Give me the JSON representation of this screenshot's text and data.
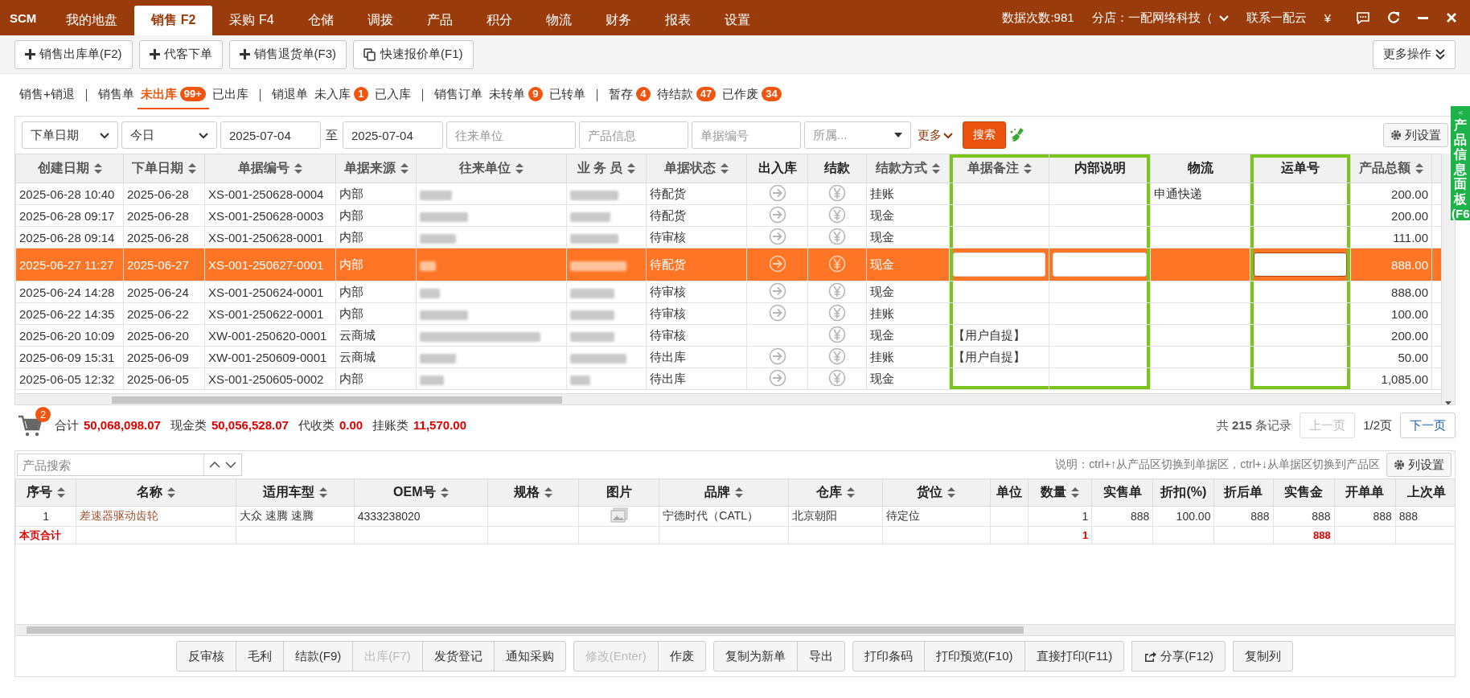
{
  "topbar": {
    "logo": "SCM",
    "menu": [
      {
        "label": "我的地盘",
        "selected": false
      },
      {
        "label": "销售 F2",
        "selected": true
      },
      {
        "label": "采购 F4",
        "selected": false
      },
      {
        "label": "仓储",
        "selected": false
      },
      {
        "label": "调拨",
        "selected": false
      },
      {
        "label": "产品",
        "selected": false
      },
      {
        "label": "积分",
        "selected": false
      },
      {
        "label": "物流",
        "selected": false
      },
      {
        "label": "财务",
        "selected": false
      },
      {
        "label": "报表",
        "selected": false
      },
      {
        "label": "设置",
        "selected": false
      }
    ],
    "data_count": "数据次数:981",
    "branch": "分店：一配网络科技（",
    "contact": "联系一配云",
    "currency": "¥"
  },
  "toolbar": {
    "buttons": [
      {
        "label": "销售出库单(F2)",
        "kind": "add"
      },
      {
        "label": "代客下单",
        "kind": "add"
      },
      {
        "label": "销售退货单(F3)",
        "kind": "add"
      },
      {
        "label": "快速报价单(F1)",
        "kind": "copy"
      }
    ],
    "more": "更多操作"
  },
  "status_tabs": [
    [
      {
        "label": "销售+销退",
        "selected": false
      }
    ],
    [
      {
        "label": "销售单",
        "selected": false
      },
      {
        "label": "未出库",
        "count": "99+",
        "selected": true
      },
      {
        "label": "已出库",
        "selected": false
      }
    ],
    [
      {
        "label": "销退单",
        "selected": false
      },
      {
        "label": "未入库",
        "count": "1",
        "selected": false
      },
      {
        "label": "已入库",
        "selected": false
      }
    ],
    [
      {
        "label": "销售订单",
        "selected": false
      },
      {
        "label": "未转单",
        "count": "9",
        "selected": false
      },
      {
        "label": "已转单",
        "selected": false
      }
    ],
    [
      {
        "label": "暂存",
        "count": "4",
        "selected": false
      },
      {
        "label": "待结款",
        "count": "47",
        "selected": false
      },
      {
        "label": "已作废",
        "count": "34",
        "selected": false
      }
    ]
  ],
  "filters": {
    "date_type": "下单日期",
    "period": "今日",
    "date_from": "2025-07-04",
    "to": "至",
    "date_to": "2025-07-04",
    "partner": {
      "placeholder": "往来单位"
    },
    "product": {
      "placeholder": "产品信息"
    },
    "order_no": {
      "placeholder": "单据编号"
    },
    "owner": {
      "placeholder": "所属..."
    },
    "more": "更多",
    "search": "搜索",
    "column_settings": "列设置"
  },
  "orders": {
    "columns": [
      {
        "label": "创建日期",
        "sortable": true,
        "kind": "text"
      },
      {
        "label": "下单日期",
        "sortable": true,
        "kind": "text"
      },
      {
        "label": "单据编号",
        "sortable": true,
        "kind": "text"
      },
      {
        "label": "单据来源",
        "sortable": true,
        "kind": "text"
      },
      {
        "label": "往来单位",
        "sortable": true,
        "kind": "blurred"
      },
      {
        "label": "业 务 员",
        "sortable": true,
        "kind": "blurred"
      },
      {
        "label": "单据状态",
        "sortable": true,
        "kind": "text"
      },
      {
        "label": "出入库",
        "sortable": false,
        "kind": "arrow"
      },
      {
        "label": "结款",
        "sortable": false,
        "kind": "yen"
      },
      {
        "label": "结款方式",
        "sortable": true,
        "kind": "text"
      },
      {
        "label": "单据备注",
        "sortable": true,
        "kind": "text",
        "highlighted": true,
        "editable": true
      },
      {
        "label": "内部说明",
        "sortable": false,
        "kind": "text",
        "highlighted": true,
        "editable": true
      },
      {
        "label": "物流",
        "sortable": false,
        "kind": "text"
      },
      {
        "label": "运单号",
        "sortable": false,
        "kind": "text",
        "highlighted": true,
        "editable": true,
        "focused": true
      },
      {
        "label": "产品总额",
        "sortable": true,
        "kind": "number"
      }
    ],
    "rows": [
      {
        "selected": false,
        "outbound": true,
        "cells": [
          "2025-06-28 10:40",
          "2025-06-28",
          "XS-001-250628-0004",
          "内部",
          null,
          null,
          "待配货",
          null,
          null,
          "挂账",
          null,
          null,
          "申通快递",
          null,
          "200.00"
        ]
      },
      {
        "selected": false,
        "outbound": true,
        "cells": [
          "2025-06-28 09:17",
          "2025-06-28",
          "XS-001-250628-0003",
          "内部",
          null,
          null,
          "待配货",
          null,
          null,
          "现金",
          null,
          null,
          null,
          null,
          "200.00"
        ]
      },
      {
        "selected": false,
        "outbound": true,
        "cells": [
          "2025-06-28 09:14",
          "2025-06-28",
          "XS-001-250628-0001",
          "内部",
          null,
          null,
          "待审核",
          null,
          null,
          "现金",
          null,
          null,
          null,
          null,
          "111.00"
        ]
      },
      {
        "selected": true,
        "outbound": true,
        "cells": [
          "2025-06-27 11:27",
          "2025-06-27",
          "XS-001-250627-0001",
          "内部",
          null,
          null,
          "待配货",
          null,
          null,
          "现金",
          null,
          null,
          null,
          null,
          "888.00"
        ]
      },
      {
        "selected": false,
        "outbound": true,
        "cells": [
          "2025-06-24 14:28",
          "2025-06-24",
          "XS-001-250624-0001",
          "内部",
          null,
          null,
          "待审核",
          null,
          null,
          "现金",
          null,
          null,
          null,
          null,
          "888.00"
        ]
      },
      {
        "selected": false,
        "outbound": true,
        "cells": [
          "2025-06-22 14:35",
          "2025-06-22",
          "XS-001-250622-0001",
          "内部",
          null,
          null,
          "待审核",
          null,
          null,
          "挂账",
          null,
          null,
          null,
          null,
          "100.00"
        ]
      },
      {
        "selected": false,
        "outbound": false,
        "cells": [
          "2025-06-20 10:09",
          "2025-06-20",
          "XW-001-250620-0001",
          "云商城",
          null,
          null,
          "待审核",
          null,
          null,
          "现金",
          "【用户自提】",
          null,
          null,
          null,
          "200.00"
        ]
      },
      {
        "selected": false,
        "outbound": true,
        "cells": [
          "2025-06-09 15:31",
          "2025-06-09",
          "XW-001-250609-0001",
          "云商城",
          null,
          null,
          "待出库",
          null,
          null,
          "挂账",
          "【用户自提】",
          null,
          null,
          null,
          "50.00"
        ]
      },
      {
        "selected": false,
        "outbound": true,
        "cells": [
          "2025-06-05 12:32",
          "2025-06-05",
          "XS-001-250605-0002",
          "内部",
          null,
          null,
          "待出库",
          null,
          null,
          "现金",
          null,
          null,
          null,
          null,
          "1,085.00"
        ]
      }
    ]
  },
  "summary": {
    "cart_count": "2",
    "totals": [
      {
        "label": "合计",
        "value": "50,068,098.07"
      },
      {
        "label": "现金类",
        "value": "50,056,528.07"
      },
      {
        "label": "代收类",
        "value": "0.00"
      },
      {
        "label": "挂账类",
        "value": "11,570.00"
      }
    ],
    "records": "共 **215** 条记录",
    "prev": {
      "label": "上一页",
      "disabled": true
    },
    "page": "1/2页",
    "next": {
      "label": "下一页",
      "disabled": false
    }
  },
  "products": {
    "search": {
      "placeholder": "产品搜索"
    },
    "hint": "说明：ctrl+↑从产品区切换到单据区，ctrl+↓从单据区切换到产品区",
    "column_settings": "列设置",
    "columns": [
      {
        "label": "序号",
        "sortable": true,
        "kind": "center",
        "page_total": "本页合计"
      },
      {
        "label": "名称",
        "sortable": true,
        "kind": "link"
      },
      {
        "label": "适用车型",
        "sortable": true,
        "kind": "text"
      },
      {
        "label": "OEM号",
        "sortable": true,
        "kind": "text"
      },
      {
        "label": "规格",
        "sortable": true,
        "kind": "text"
      },
      {
        "label": "图片",
        "sortable": false,
        "kind": "image"
      },
      {
        "label": "品牌",
        "sortable": true,
        "kind": "text"
      },
      {
        "label": "仓库",
        "sortable": true,
        "kind": "text"
      },
      {
        "label": "货位",
        "sortable": true,
        "kind": "text"
      },
      {
        "label": "单位",
        "sortable": false,
        "kind": "text"
      },
      {
        "label": "数量",
        "sortable": true,
        "kind": "number",
        "page_total": "1"
      },
      {
        "label": "实售单",
        "sortable": false,
        "kind": "number"
      },
      {
        "label": "折扣(%)",
        "sortable": false,
        "kind": "number"
      },
      {
        "label": "折后单",
        "sortable": false,
        "kind": "number"
      },
      {
        "label": "实售金",
        "sortable": false,
        "kind": "number",
        "page_total": "888"
      },
      {
        "label": "开单单",
        "sortable": false,
        "kind": "number"
      },
      {
        "label": "上次单",
        "sortable": false,
        "kind": "text"
      }
    ],
    "rows": [
      {
        "cells": [
          "1",
          "差速器驱动齿轮",
          "大众 速腾 速腾",
          "4333238020",
          null,
          null,
          "宁德时代（CATL）",
          "北京朝阳",
          "待定位",
          null,
          "1",
          "888",
          "100.00",
          "888",
          "888",
          "888",
          "888"
        ]
      }
    ]
  },
  "actions": [
    [
      {
        "label": "反审核",
        "disabled": false,
        "kind": "plain"
      },
      {
        "label": "毛利",
        "disabled": false,
        "kind": "plain"
      },
      {
        "label": "结款(F9)",
        "disabled": false,
        "kind": "plain"
      },
      {
        "label": "出库(F7)",
        "disabled": true,
        "kind": "plain"
      },
      {
        "label": "发货登记",
        "disabled": false,
        "kind": "plain"
      },
      {
        "label": "通知采购",
        "disabled": false,
        "kind": "plain"
      }
    ],
    [
      {
        "label": "修改(Enter)",
        "disabled": true,
        "kind": "plain"
      },
      {
        "label": "作废",
        "disabled": false,
        "kind": "plain"
      }
    ],
    [
      {
        "label": "复制为新单",
        "disabled": false,
        "kind": "plain"
      },
      {
        "label": "导出",
        "disabled": false,
        "kind": "plain"
      }
    ],
    [
      {
        "label": "打印条码",
        "disabled": false,
        "kind": "plain"
      },
      {
        "label": "打印预览(F10)",
        "disabled": false,
        "kind": "plain"
      },
      {
        "label": "直接打印(F11)",
        "disabled": false,
        "kind": "plain"
      }
    ],
    [
      {
        "label": "分享(F12)",
        "disabled": false,
        "kind": "share"
      }
    ],
    [
      {
        "label": "复制列",
        "disabled": false,
        "kind": "plain"
      }
    ]
  ],
  "side_panel": {
    "title": "产品信息面板",
    "shortcut": "(F6"
  }
}
